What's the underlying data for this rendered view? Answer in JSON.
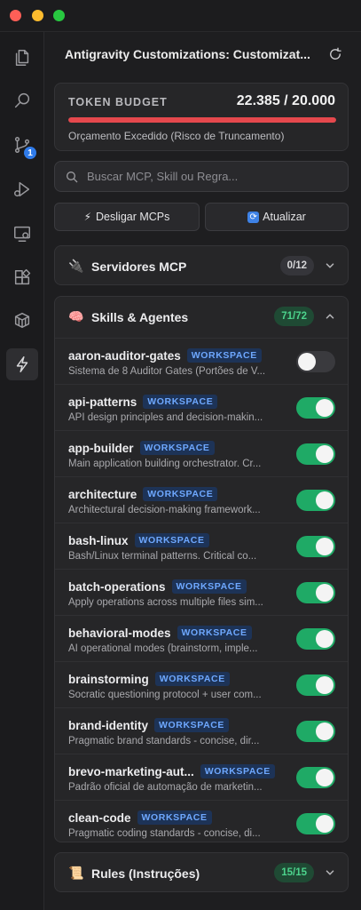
{
  "window": {
    "controls": [
      "close",
      "minimize",
      "maximize"
    ]
  },
  "activity_bar": {
    "items": [
      {
        "name": "explorer-icon"
      },
      {
        "name": "search-icon"
      },
      {
        "name": "source-control-icon",
        "badge": "1"
      },
      {
        "name": "run-debug-icon"
      },
      {
        "name": "remote-explorer-icon"
      },
      {
        "name": "extensions-icon"
      },
      {
        "name": "containers-icon"
      },
      {
        "name": "lightning-icon",
        "active": true
      }
    ]
  },
  "header": {
    "title": "Antigravity Customizations: Customizat..."
  },
  "token_budget": {
    "label": "TOKEN BUDGET",
    "value": "22.385 / 20.000",
    "usage_fraction": 1.0,
    "status": "Orçamento Excedido (Risco de Truncamento)",
    "bar_color": "#e5484d"
  },
  "search": {
    "placeholder": "Buscar MCP, Skill ou Regra..."
  },
  "actions": {
    "disable_mcps": {
      "icon": "⚡",
      "label": "Desligar MCPs"
    },
    "refresh": {
      "icon": "🔄",
      "label": "Atualizar"
    }
  },
  "sections": {
    "mcp": {
      "icon": "🔌",
      "title": "Servidores MCP",
      "count": "0/12"
    },
    "skills": {
      "icon": "🧠",
      "title": "Skills & Agentes",
      "count": "71/72"
    },
    "rules": {
      "icon": "📜",
      "title": "Rules (Instruções)",
      "count": "15/15"
    }
  },
  "skills": [
    {
      "name": "aaron-auditor-gates",
      "badge": "WORKSPACE",
      "desc": "Sistema de 8 Auditor Gates (Portões de V...",
      "enabled": false
    },
    {
      "name": "api-patterns",
      "badge": "WORKSPACE",
      "desc": "API design principles and decision-makin...",
      "enabled": true
    },
    {
      "name": "app-builder",
      "badge": "WORKSPACE",
      "desc": "Main application building orchestrator. Cr...",
      "enabled": true
    },
    {
      "name": "architecture",
      "badge": "WORKSPACE",
      "desc": "Architectural decision-making framework...",
      "enabled": true
    },
    {
      "name": "bash-linux",
      "badge": "WORKSPACE",
      "desc": "Bash/Linux terminal patterns. Critical co...",
      "enabled": true
    },
    {
      "name": "batch-operations",
      "badge": "WORKSPACE",
      "desc": "Apply operations across multiple files sim...",
      "enabled": true
    },
    {
      "name": "behavioral-modes",
      "badge": "WORKSPACE",
      "desc": "AI operational modes (brainstorm, imple...",
      "enabled": true
    },
    {
      "name": "brainstorming",
      "badge": "WORKSPACE",
      "desc": "Socratic questioning protocol + user com...",
      "enabled": true
    },
    {
      "name": "brand-identity",
      "badge": "WORKSPACE",
      "desc": "Pragmatic brand standards - concise, dir...",
      "enabled": true
    },
    {
      "name": "brevo-marketing-aut...",
      "badge": "WORKSPACE",
      "desc": "Padrão oficial de automação de marketin...",
      "enabled": true
    },
    {
      "name": "clean-code",
      "badge": "WORKSPACE",
      "desc": "Pragmatic coding standards - concise, di...",
      "enabled": true
    }
  ]
}
